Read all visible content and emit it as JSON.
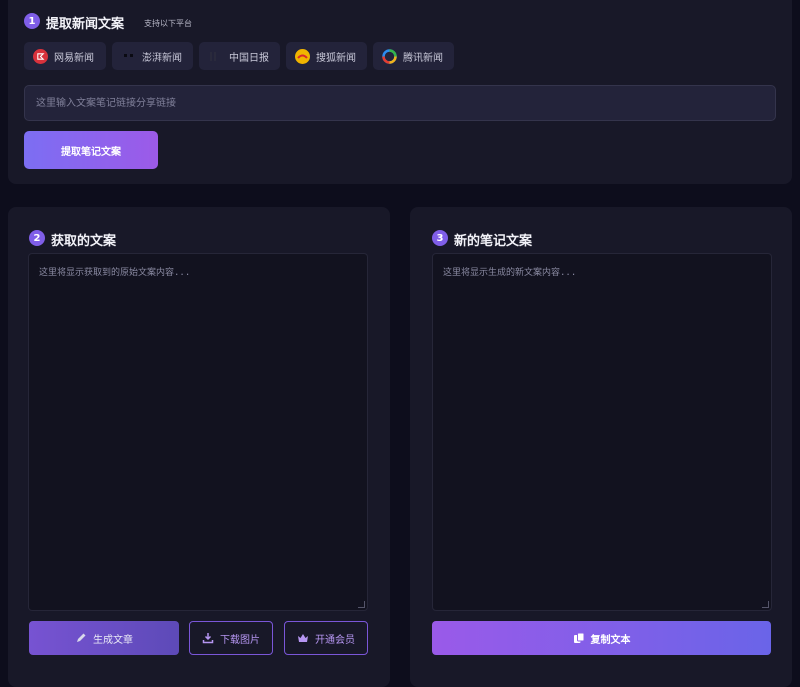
{
  "extract": {
    "step": "1",
    "title": "提取新闻文案",
    "subnote": "支持以下平台",
    "input_placeholder": "这里输入文案笔记链接分享链接",
    "button_label": "提取笔记文案",
    "platforms": [
      {
        "label": "网易新闻",
        "icon": "netease-logo-icon",
        "color": "#d9323c"
      },
      {
        "label": "澎湃新闻",
        "icon": "thepaper-logo-icon",
        "color": "#1a1a2a"
      },
      {
        "label": "中国日报",
        "icon": "chinadaily-logo-icon",
        "color": "#2a2a3a"
      },
      {
        "label": "搜狐新闻",
        "icon": "sohu-logo-icon",
        "color": "#f0b400"
      },
      {
        "label": "腾讯新闻",
        "icon": "tencent-logo-icon",
        "color": "#2c8cf0"
      }
    ]
  },
  "original": {
    "step": "2",
    "title": "获取的文案",
    "placeholder": "这里将显示获取到的原始文案内容...",
    "generate_label": "生成文章",
    "download_label": "下载图片",
    "vip_label": "开通会员"
  },
  "rewrite": {
    "step": "3",
    "title": "新的笔记文案",
    "placeholder": "这里将显示生成的新文案内容...",
    "copy_label": "复制文本"
  },
  "colors": {
    "accent": "#7f5ee8",
    "background": "#0d0d1c",
    "panel": "#181828"
  }
}
